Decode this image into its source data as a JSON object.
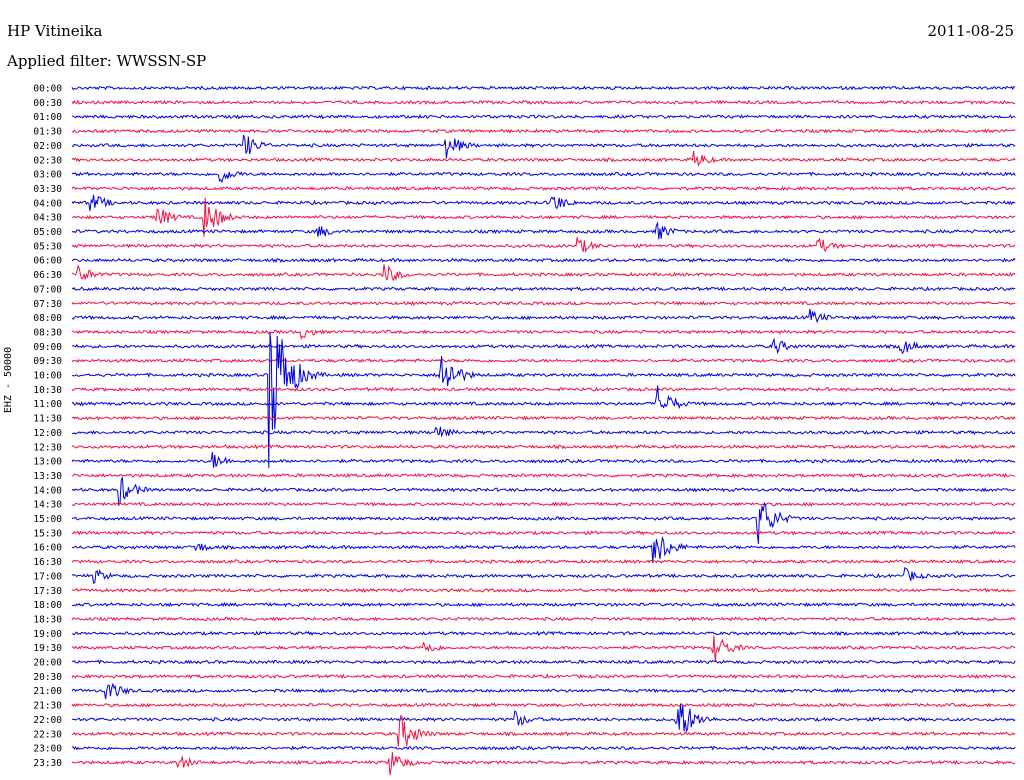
{
  "header": {
    "station": "HP Vitineika",
    "date": "2011-08-25",
    "filter": "Applied filter: WWSSN-SP"
  },
  "chart_data": {
    "type": "line",
    "ylabel": "EHZ - 50000",
    "rows": [
      "00:00",
      "00:30",
      "01:00",
      "01:30",
      "02:00",
      "02:30",
      "03:00",
      "03:30",
      "04:00",
      "04:30",
      "05:00",
      "05:30",
      "06:00",
      "06:30",
      "07:00",
      "07:30",
      "08:00",
      "08:30",
      "09:00",
      "09:30",
      "10:00",
      "10:30",
      "11:00",
      "11:30",
      "12:00",
      "12:30",
      "13:00",
      "13:30",
      "14:00",
      "14:30",
      "15:00",
      "15:30",
      "16:00",
      "16:30",
      "17:00",
      "17:30",
      "18:00",
      "18:30",
      "19:00",
      "19:30",
      "20:00",
      "20:30",
      "21:00",
      "21:30",
      "22:00",
      "22:30",
      "23:00",
      "23:30"
    ],
    "colors": [
      "#0000dd",
      "#ee1144"
    ],
    "x_range_minutes": [
      0,
      30
    ],
    "events": [
      {
        "row": "02:00",
        "minute": 5.5,
        "amp": 12
      },
      {
        "row": "02:00",
        "minute": 11.9,
        "amp": 14
      },
      {
        "row": "02:30",
        "minute": 19.8,
        "amp": 9
      },
      {
        "row": "03:00",
        "minute": 4.7,
        "amp": 10
      },
      {
        "row": "04:00",
        "minute": 0.6,
        "amp": 11
      },
      {
        "row": "04:00",
        "minute": 15.2,
        "amp": 12
      },
      {
        "row": "04:30",
        "minute": 2.7,
        "amp": 12
      },
      {
        "row": "04:30",
        "minute": 4.2,
        "amp": 22
      },
      {
        "row": "05:00",
        "minute": 7.8,
        "amp": 8
      },
      {
        "row": "05:00",
        "minute": 18.6,
        "amp": 10
      },
      {
        "row": "05:30",
        "minute": 16.1,
        "amp": 9
      },
      {
        "row": "05:30",
        "minute": 23.7,
        "amp": 9
      },
      {
        "row": "06:30",
        "minute": 9.9,
        "amp": 12
      },
      {
        "row": "06:30",
        "minute": 0.2,
        "amp": 10
      },
      {
        "row": "08:00",
        "minute": 23.5,
        "amp": 8
      },
      {
        "row": "08:30",
        "minute": 7.3,
        "amp": 7
      },
      {
        "row": "09:00",
        "minute": 22.3,
        "amp": 9
      },
      {
        "row": "09:00",
        "minute": 26.3,
        "amp": 10
      },
      {
        "row": "10:00",
        "minute": 6.3,
        "amp": 90
      },
      {
        "row": "10:00",
        "minute": 11.7,
        "amp": 28
      },
      {
        "row": "11:00",
        "minute": 18.6,
        "amp": 20
      },
      {
        "row": "12:00",
        "minute": 11.6,
        "amp": 8
      },
      {
        "row": "13:00",
        "minute": 4.5,
        "amp": 9
      },
      {
        "row": "14:00",
        "minute": 1.5,
        "amp": 16
      },
      {
        "row": "15:00",
        "minute": 21.8,
        "amp": 28
      },
      {
        "row": "16:00",
        "minute": 18.5,
        "amp": 22
      },
      {
        "row": "16:00",
        "minute": 3.9,
        "amp": 7
      },
      {
        "row": "17:00",
        "minute": 0.7,
        "amp": 8
      },
      {
        "row": "17:00",
        "minute": 26.5,
        "amp": 8
      },
      {
        "row": "19:30",
        "minute": 11.2,
        "amp": 8
      },
      {
        "row": "19:30",
        "minute": 20.4,
        "amp": 16
      },
      {
        "row": "21:00",
        "minute": 1.1,
        "amp": 12
      },
      {
        "row": "22:00",
        "minute": 14.1,
        "amp": 9
      },
      {
        "row": "22:00",
        "minute": 19.2,
        "amp": 30
      },
      {
        "row": "22:30",
        "minute": 10.4,
        "amp": 22
      },
      {
        "row": "23:30",
        "minute": 3.4,
        "amp": 8
      },
      {
        "row": "23:30",
        "minute": 10.1,
        "amp": 14
      }
    ]
  }
}
